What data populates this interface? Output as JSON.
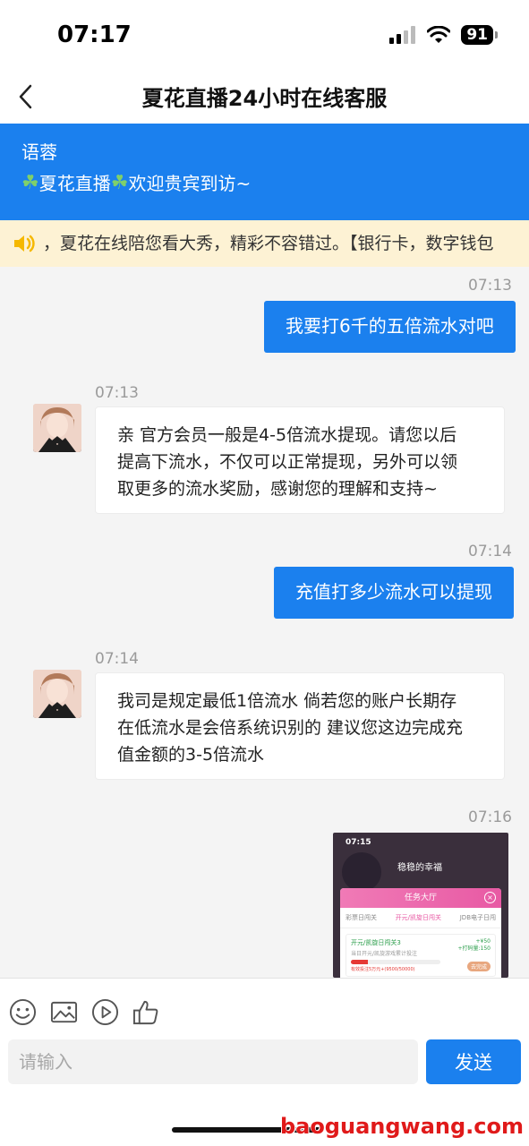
{
  "status_bar": {
    "time": "07:17",
    "battery": "91"
  },
  "nav": {
    "title": "夏花直播24小时在线客服"
  },
  "agent": {
    "name": "语蓉",
    "welcome_text": "夏花直播",
    "welcome_suffix": "欢迎贵宾到访~"
  },
  "notice": {
    "text": "，夏花在线陪您看大秀，精彩不容错过。【银行卡，数字钱包"
  },
  "messages": [
    {
      "time": "07:13",
      "direction": "outgoing",
      "text": "我要打6千的五倍流水对吧"
    },
    {
      "time": "07:13",
      "direction": "incoming",
      "lines": [
        "亲 官方会员一般是4-5倍流水提现。请您以后",
        "提高下流水，不仅可以正常提现，另外可以领",
        "取更多的流水奖励，感谢您的理解和支持~"
      ]
    },
    {
      "time": "07:14",
      "direction": "outgoing",
      "text": "充值打多少流水可以提现"
    },
    {
      "time": "07:14",
      "direction": "incoming",
      "lines": [
        "我司是规定最低1倍流水 倘若您的账户长期存",
        "在低流水是会倍系统识别的 建议您这边完成充",
        "值金额的3-5倍流水"
      ]
    },
    {
      "time": "07:16",
      "direction": "outgoing",
      "type": "image"
    }
  ],
  "image_content": {
    "status_time": "07:15",
    "username": "稳稳的幸福",
    "panel_title": "任务大厅",
    "tabs": [
      "彩票日闯关",
      "开元/凯旋日闯关",
      "JDB电子日闯"
    ],
    "task_title": "开元/凯旋日闯关3",
    "task_desc": "当日开元/凯旋游戏累计投注",
    "task_progress_text": "有效投注5万元+(9500/50000)",
    "task_progress": 0.19,
    "reward_line1": "+¥50",
    "reward_line2": "+打码量:150",
    "go_button": "去完成"
  },
  "input": {
    "placeholder": "请输入"
  },
  "send_button": "发送",
  "watermark": "baoguangwang.com",
  "colors": {
    "primary": "#1b80ee",
    "notice_bg": "#fdf2d4",
    "watermark": "#e01a1a"
  }
}
